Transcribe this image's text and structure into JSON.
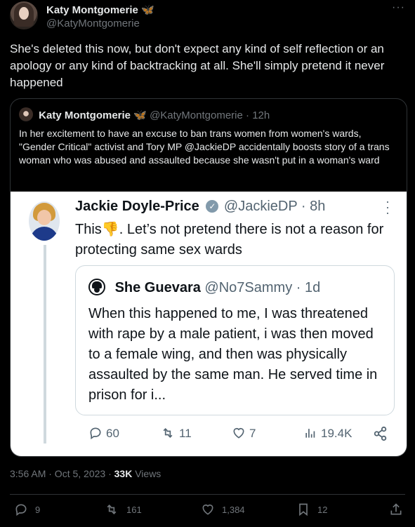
{
  "tweet": {
    "author_name": "Katy Montgomerie",
    "author_emoji": "🦋",
    "author_handle": "@KatyMontgomerie",
    "more": "···",
    "text": "She's deleted this now, but don't expect any kind of self reflection or an apology or any kind of backtracking at all. She'll simply pretend it never happened",
    "time": "3:56 AM · Oct 5, 2023 · ",
    "views_count": "33K",
    "views_label": " Views"
  },
  "quote": {
    "author_name": "Katy Montgomerie",
    "author_emoji": "🦋",
    "author_handle": "@KatyMontgomerie",
    "time": "12h",
    "text": "In her excitement to have an excuse to ban trans women from women's wards, \"Gender Critical\" activist and Tory MP @JackieDP accidentally boosts story of a trans woman who was abused and assaulted because she wasn't put in a woman's ward"
  },
  "embed": {
    "author_name": "Jackie Doyle-Price",
    "author_handle": "@JackieDP",
    "time": "8h",
    "text_before": "This",
    "thumb": "👎",
    "text_after": ". Let’s not pretend there is not a reason for protecting same sex wards",
    "inner": {
      "author_name": "She Guevara",
      "author_handle": "@No7Sammy",
      "time": "1d",
      "text": "When this happened to me, I was threatened with rape by a male patient, i was then moved to a female wing, and then was physically assaulted by the same man. He served time in prison for i..."
    },
    "actions": {
      "replies": "60",
      "retweets": "11",
      "likes": "7",
      "views": "19.4K"
    }
  },
  "actions": {
    "replies": "9",
    "retweets": "161",
    "likes": "1,384",
    "bookmarks": "12"
  },
  "icons": {
    "reply": "reply-icon",
    "retweet": "retweet-icon",
    "like": "heart-icon",
    "views": "views-icon",
    "share": "share-icon",
    "bookmark": "bookmark-icon",
    "verified": "verified-icon"
  },
  "colors": {
    "background": "#000000",
    "text": "#e7e9ea",
    "muted": "#71767b",
    "embed_bg": "#ffffff",
    "verified_grey": "#829aab"
  }
}
